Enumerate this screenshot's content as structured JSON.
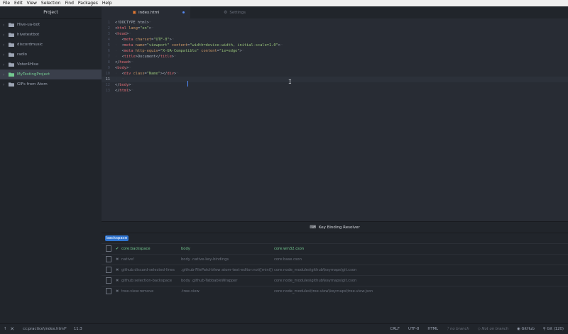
{
  "menu": [
    "File",
    "Edit",
    "View",
    "Selection",
    "Find",
    "Packages",
    "Help"
  ],
  "tree": {
    "header": "Project",
    "items": [
      {
        "label": "Hive-ua-bot",
        "selected": false
      },
      {
        "label": "hivetestbot",
        "selected": false
      },
      {
        "label": "discordmusic",
        "selected": false
      },
      {
        "label": "radio",
        "selected": false
      },
      {
        "label": "Voter4Hive",
        "selected": false
      },
      {
        "label": "MyTestingProject",
        "selected": true
      },
      {
        "label": "GIFs from Atom",
        "selected": false
      }
    ]
  },
  "tabs": [
    {
      "label": "index.html",
      "icon": "html-file-icon",
      "active": true,
      "modified": true
    },
    {
      "label": "Settings",
      "icon": "settings-gear-icon",
      "active": false,
      "modified": false
    }
  ],
  "editor": {
    "cursor_line": 11,
    "lines": [
      "1",
      "2",
      "3",
      "4",
      "5",
      "6",
      "7",
      "8",
      "9",
      "10",
      "11",
      "12",
      "13"
    ]
  },
  "resolver": {
    "title": "Key Binding Resolver",
    "keystroke": "backspace",
    "bindings": [
      {
        "command": "core:backspace",
        "selector": "body",
        "source": "core:win32.cson",
        "matched": true
      },
      {
        "command": "native!",
        "selector": "body .native-key-bindings",
        "source": "core:base.cson",
        "matched": false
      },
      {
        "command": "github:discard-selected-lines",
        "selector": ".github-FilePatchView atom-text-editor:not([mini])",
        "source": "core:node_modules\\github\\keymaps\\git.cson",
        "matched": false
      },
      {
        "command": "github:selection-backspace",
        "selector": "body .github-TabbableWrapper",
        "source": "core:node_modules\\github\\keymaps\\git.cson",
        "matched": false
      },
      {
        "command": "tree-view:remove",
        "selector": ".tree-view",
        "source": "core:node_modules\\tree-view\\keymaps\\tree-view.json",
        "matched": false
      }
    ]
  },
  "status": {
    "file_path": "cc:practice\\index.html*",
    "cursor_pos": "11:3",
    "line_ending": "CRLF",
    "encoding": "UTF-8",
    "grammar": "HTML",
    "branch": "no branch",
    "not_on_branch": "Not on branch",
    "github": "GitHub",
    "git": "Git (120)"
  },
  "colors": {
    "accent": "#568af2",
    "selected_green": "#73c990",
    "keystroke_bg": "#2f74d0"
  }
}
